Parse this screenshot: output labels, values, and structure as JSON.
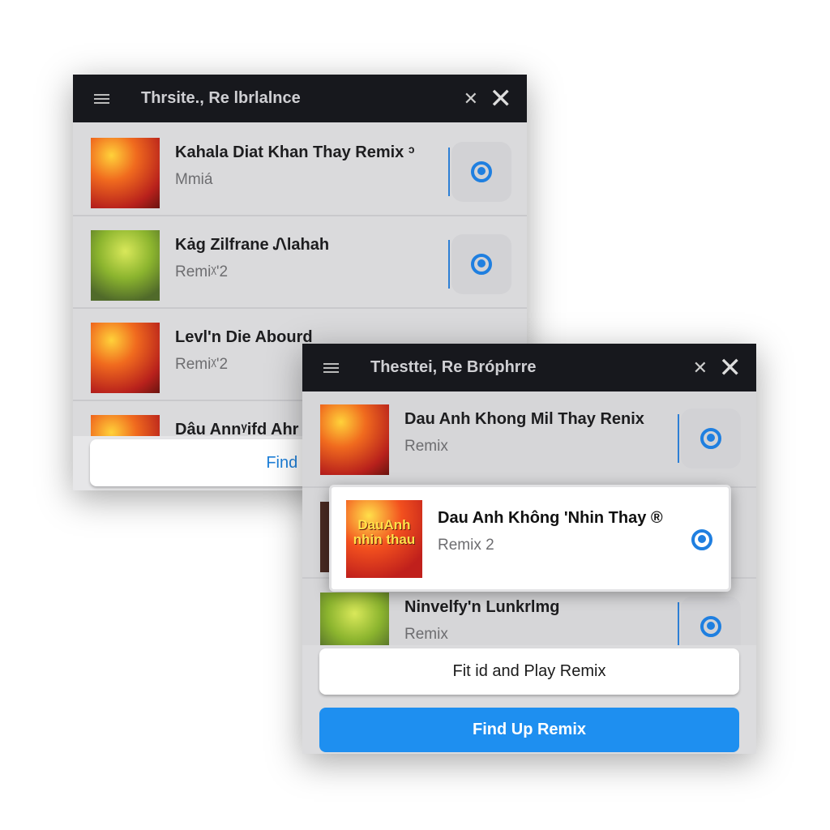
{
  "back_panel": {
    "title": "Thrsite., Re lbrlalnce",
    "items": [
      {
        "title": "Kahala Diat Khan Thay Remix ᵓ",
        "subtitle": "Mmiá"
      },
      {
        "title": "Kȧg Zilfrane Ꮑlahah",
        "subtitle": "Remiᵡ'2"
      },
      {
        "title": "Levl'n Die Abourd",
        "subtitle": "Remiᵡ'2"
      },
      {
        "title": "Dâu Annᵞifd Ahr",
        "subtitle": ""
      }
    ],
    "button_label": "Find Play"
  },
  "front_panel": {
    "title": "Thesttei, Re Bróphrre",
    "items": [
      {
        "title": "Dau Anh Khong Mil Thay Renix",
        "subtitle": "Remix"
      },
      {
        "title": "Ninvelfy'n Lunkrlmg",
        "subtitle": "Remix"
      }
    ],
    "highlighted": {
      "title": "Dau Anh Không 'Nhin Thay ®",
      "subtitle": "Remix 2",
      "art_text": "DauAnh nhin thau"
    },
    "secondary_button": "Fit id and Play Remix",
    "primary_button": "Find Up Remix"
  },
  "colors": {
    "accent": "#1e8ff0",
    "header": "#17181d"
  },
  "icons": {
    "menu": "hamburger-menu-icon",
    "close": "close-icon",
    "play": "play-circle-icon"
  }
}
